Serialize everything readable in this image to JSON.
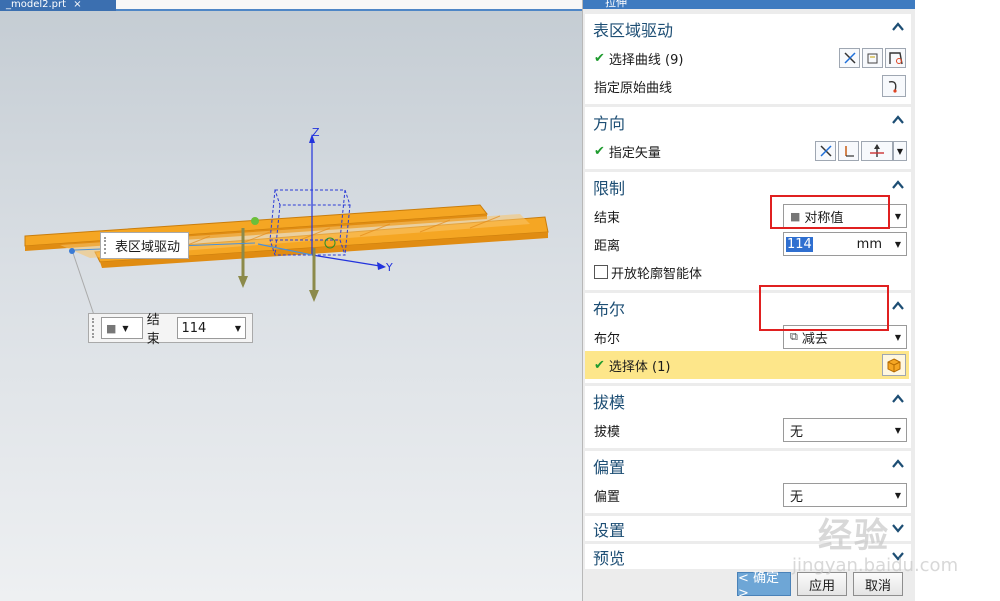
{
  "file_tab": {
    "label": "_model2.prt",
    "close": "×"
  },
  "viewport": {
    "axis_x": "X",
    "axis_y": "Y",
    "axis_z": "Z",
    "drive_label": "表区域驱动",
    "end_box": {
      "label": "结束",
      "value": "114"
    }
  },
  "dialog": {
    "title": "拉伸",
    "sections": {
      "drive": {
        "title": "表区域驱动",
        "select_curve": "选择曲线 (9)",
        "specify_curve": "指定原始曲线"
      },
      "direction": {
        "title": "方向",
        "specify_vector": "指定矢量"
      },
      "limits": {
        "title": "限制",
        "end_label": "结束",
        "end_value": "对称值",
        "distance_label": "距离",
        "distance_value": "114",
        "distance_unit": "mm",
        "open_profile": "开放轮廓智能体"
      },
      "boolean": {
        "title": "布尔",
        "bool_label": "布尔",
        "bool_value": "减去",
        "select_body": "选择体 (1)"
      },
      "draft": {
        "title": "拔模",
        "draft_label": "拔模",
        "draft_value": "无"
      },
      "offset": {
        "title": "偏置",
        "offset_label": "偏置",
        "offset_value": "无"
      },
      "settings": {
        "title": "设置"
      },
      "preview": {
        "title": "预览"
      }
    },
    "buttons": {
      "ok": "< 确定 >",
      "apply": "应用",
      "cancel": "取消"
    }
  },
  "colors": {
    "accent": "#1d4e74",
    "title_bar": "#3e7bc0",
    "highlight": "#fde68a",
    "annotation": "#e02020",
    "model": "#f5a623"
  },
  "icons": [
    "check-icon",
    "curve-select-icon",
    "vector-icon",
    "solid-body-icon",
    "subtract-icon",
    "collapse-caret-icon",
    "expand-caret-icon"
  ],
  "watermark": {
    "text": "经验",
    "sub": "jingyan.baidu.com"
  }
}
